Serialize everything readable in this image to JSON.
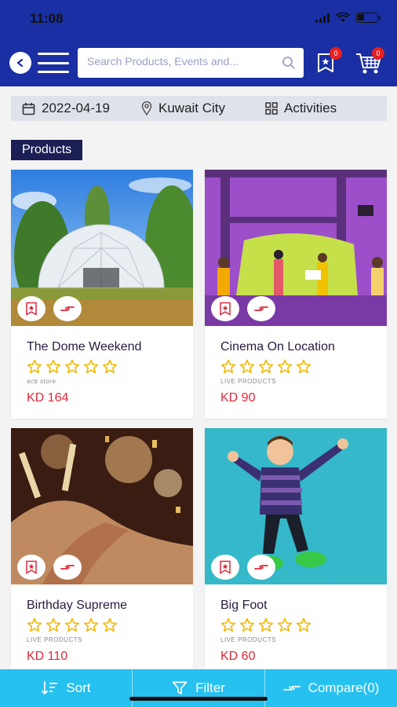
{
  "status": {
    "time": "11:08"
  },
  "header": {
    "search_placeholder": "Search Products, Events and...",
    "wishlist_count": "0",
    "cart_count": "0"
  },
  "filters": {
    "date": "2022-04-19",
    "location": "Kuwait City",
    "category": "Activities"
  },
  "section_title": "Products",
  "products": [
    {
      "title": "The Dome Weekend",
      "store": "acb store",
      "price": "KD 164",
      "rating": 0
    },
    {
      "title": "Cinema On Location",
      "store": "LIVE PRODUCTS",
      "price": "KD 90",
      "rating": 0
    },
    {
      "title": "Birthday Supreme",
      "store": "LIVE PRODUCTS",
      "price": "KD 110",
      "rating": 0
    },
    {
      "title": "Big Foot",
      "store": "LIVE PRODUCTS",
      "price": "KD 60",
      "rating": 0
    }
  ],
  "bottom_bar": {
    "sort": "Sort",
    "filter": "Filter",
    "compare": "Compare(0)"
  },
  "colors": {
    "header_bg": "#1a2fa3",
    "price": "#e0283a",
    "star": "#f2b705",
    "bottom_bar": "#27c1f0",
    "section_label_bg": "#1c1f55"
  }
}
